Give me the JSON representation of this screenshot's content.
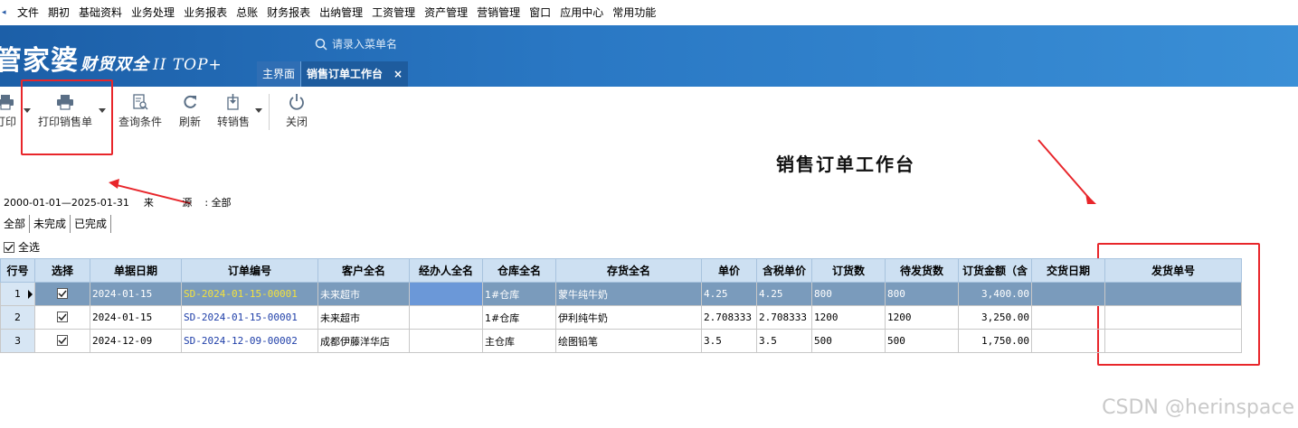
{
  "menubar": {
    "items": [
      "文件",
      "期初",
      "基础资料",
      "业务处理",
      "业务报表",
      "总账",
      "财务报表",
      "出纳管理",
      "工资管理",
      "资产管理",
      "营销管理",
      "窗口",
      "应用中心",
      "常用功能"
    ]
  },
  "banner": {
    "logo_main": "管家婆",
    "logo_sub": "财贸双全",
    "logo_version": "II TOP+",
    "search_placeholder": "请录入菜单名",
    "tabs": [
      {
        "label": "主界面",
        "active": false
      },
      {
        "label": "销售订单工作台",
        "active": true,
        "close": "×"
      }
    ]
  },
  "toolbar": {
    "print_label": "打印",
    "print_sales_label": "打印销售单",
    "query_label": "查询条件",
    "refresh_label": "刷新",
    "transfer_label": "转销售",
    "close_label": "关闭"
  },
  "page_title": "销售订单工作台",
  "filter": {
    "date_range": "2000-01-01—2025-01-31",
    "source_label": "来 源",
    "source_value": "全部"
  },
  "subtabs": [
    "全部",
    "未完成",
    "已完成"
  ],
  "select_all_label": "全选",
  "grid": {
    "columns": [
      "行号",
      "选择",
      "单据日期",
      "订单编号",
      "客户全名",
      "经办人全名",
      "仓库全名",
      "存货全名",
      "单价",
      "含税单价",
      "订货数",
      "待发货数",
      "订货金额（含",
      "交货日期",
      "发货单号"
    ],
    "rows": [
      {
        "no": "1",
        "checked": true,
        "date": "2024-01-15",
        "order": "SD-2024-01-15-00001",
        "customer": "未来超市",
        "handler": "",
        "warehouse": "1#仓库",
        "item": "蒙牛纯牛奶",
        "price": "4.25",
        "tax_price": "4.25",
        "qty": "800",
        "pending": "800",
        "amount": "3,400.00",
        "delivery_date": "",
        "ship_no": ""
      },
      {
        "no": "2",
        "checked": true,
        "date": "2024-01-15",
        "order": "SD-2024-01-15-00001",
        "customer": "未来超市",
        "handler": "",
        "warehouse": "1#仓库",
        "item": "伊利纯牛奶",
        "price": "2.708333",
        "tax_price": "2.708333",
        "qty": "1200",
        "pending": "1200",
        "amount": "3,250.00",
        "delivery_date": "",
        "ship_no": ""
      },
      {
        "no": "3",
        "checked": true,
        "date": "2024-12-09",
        "order": "SD-2024-12-09-00002",
        "customer": "成都伊藤洋华店",
        "handler": "",
        "warehouse": "主仓库",
        "item": "绘图铅笔",
        "price": "3.5",
        "tax_price": "3.5",
        "qty": "500",
        "pending": "500",
        "amount": "1,750.00",
        "delivery_date": "",
        "ship_no": ""
      }
    ]
  },
  "watermark": "CSDN @herinspace",
  "colors": {
    "banner": "#2a78c4",
    "selected_row": "#7a9bbc",
    "annotation": "#e8262b",
    "header": "#cde0f2"
  }
}
